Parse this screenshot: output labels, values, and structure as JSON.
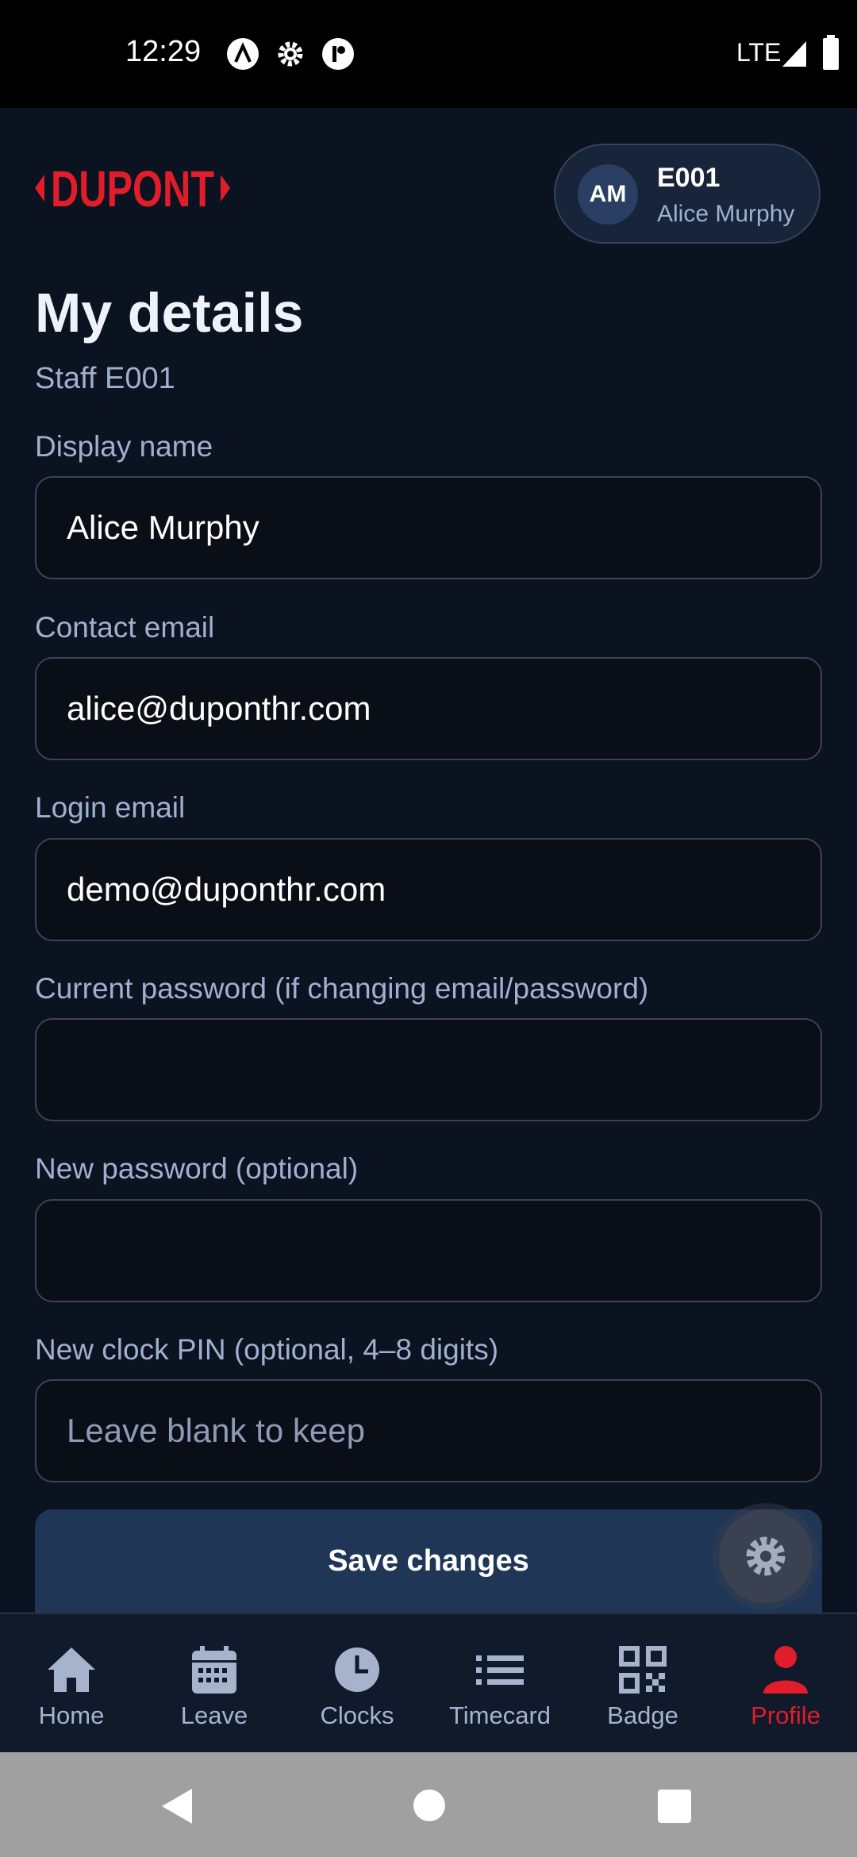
{
  "status_bar": {
    "time": "12:29",
    "network": "LTE"
  },
  "header": {
    "logo_text": "DUPONT",
    "user_chip": {
      "initials": "AM",
      "staff_id": "E001",
      "name": "Alice Murphy"
    }
  },
  "page": {
    "title": "My details",
    "subtitle": "Staff E001"
  },
  "form": {
    "display_name": {
      "label": "Display name",
      "value": "Alice Murphy"
    },
    "contact_email": {
      "label": "Contact email",
      "value": "alice@duponthr.com"
    },
    "login_email": {
      "label": "Login email",
      "value": "demo@duponthr.com"
    },
    "current_password": {
      "label": "Current password (if changing email/password)",
      "value": ""
    },
    "new_password": {
      "label": "New password (optional)",
      "value": ""
    },
    "new_pin": {
      "label": "New clock PIN (optional, 4–8 digits)",
      "value": "",
      "placeholder": "Leave blank to keep"
    },
    "save_label": "Save changes"
  },
  "bottom_nav": {
    "items": [
      {
        "label": "Home",
        "icon": "home-icon"
      },
      {
        "label": "Leave",
        "icon": "calendar-icon"
      },
      {
        "label": "Clocks",
        "icon": "clock-icon"
      },
      {
        "label": "Timecard",
        "icon": "list-icon"
      },
      {
        "label": "Badge",
        "icon": "qr-code-icon"
      },
      {
        "label": "Profile",
        "icon": "person-icon",
        "active": true
      }
    ]
  },
  "colors": {
    "accent": "#e11d2b",
    "background": "#0b1220",
    "button": "#1f3657"
  }
}
